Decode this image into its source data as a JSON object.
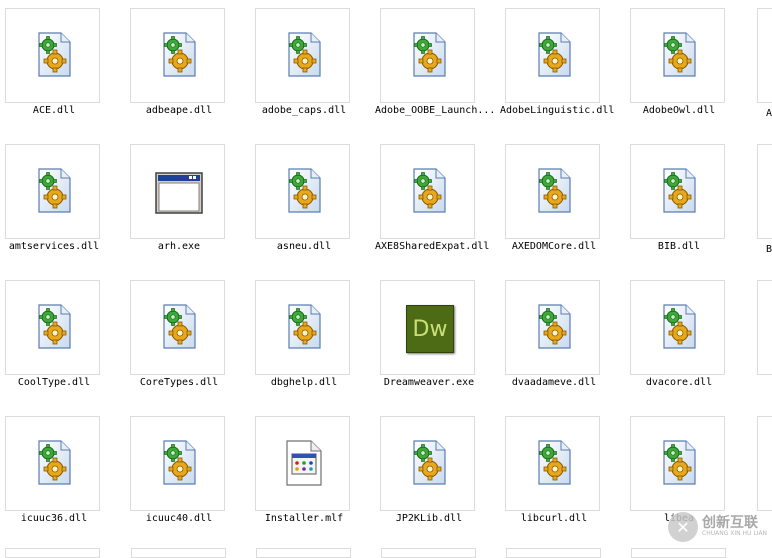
{
  "files": [
    {
      "name": "ACE.dll",
      "type": "dll"
    },
    {
      "name": "adbeape.dll",
      "type": "dll"
    },
    {
      "name": "adobe_caps.dll",
      "type": "dll"
    },
    {
      "name": "Adobe_OOBE_Launch...",
      "type": "dll"
    },
    {
      "name": "AdobeLinguistic.dll",
      "type": "dll"
    },
    {
      "name": "AdobeOwl.dll",
      "type": "dll"
    },
    {
      "name": "amtservices.dll",
      "type": "dll"
    },
    {
      "name": "arh.exe",
      "type": "exe"
    },
    {
      "name": "asneu.dll",
      "type": "dll"
    },
    {
      "name": "AXE8SharedExpat.dll",
      "type": "dll"
    },
    {
      "name": "AXEDOMCore.dll",
      "type": "dll"
    },
    {
      "name": "BIB.dll",
      "type": "dll"
    },
    {
      "name": "CoolType.dll",
      "type": "dll"
    },
    {
      "name": "CoreTypes.dll",
      "type": "dll"
    },
    {
      "name": "dbghelp.dll",
      "type": "dll"
    },
    {
      "name": "Dreamweaver.exe",
      "type": "dw",
      "icon_text": "Dw"
    },
    {
      "name": "dvaadameve.dll",
      "type": "dll"
    },
    {
      "name": "dvacore.dll",
      "type": "dll"
    },
    {
      "name": "icuuc36.dll",
      "type": "dll"
    },
    {
      "name": "icuuc40.dll",
      "type": "dll"
    },
    {
      "name": "Installer.mlf",
      "type": "mlf"
    },
    {
      "name": "JP2KLib.dll",
      "type": "dll"
    },
    {
      "name": "libcurl.dll",
      "type": "dll"
    },
    {
      "name": "libea",
      "type": "dll"
    }
  ],
  "edge_labels": {
    "row1": "A",
    "row2": "B"
  },
  "watermark": {
    "logo": "✕",
    "main": "创新互联",
    "sub": "CHUANG XIN HU LIAN"
  },
  "colors": {
    "dw_bg": "#4d6b14",
    "dw_text": "#c9e07a"
  }
}
